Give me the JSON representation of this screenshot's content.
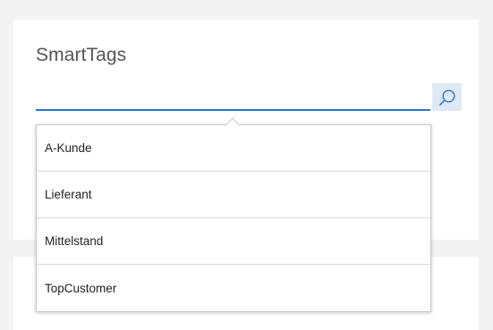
{
  "panel": {
    "title": "SmartTags"
  },
  "search": {
    "value": "",
    "placeholder": "",
    "button_icon": "search-icon"
  },
  "suggestions": {
    "items": [
      {
        "label": "A-Kunde"
      },
      {
        "label": "Lieferant"
      },
      {
        "label": "Mittelstand"
      },
      {
        "label": "TopCustomer"
      }
    ]
  },
  "colors": {
    "accent": "#2b74c9",
    "search_button_bg": "#dfe9f6",
    "page_bg": "#f3f3f3",
    "card_bg": "#ffffff"
  }
}
